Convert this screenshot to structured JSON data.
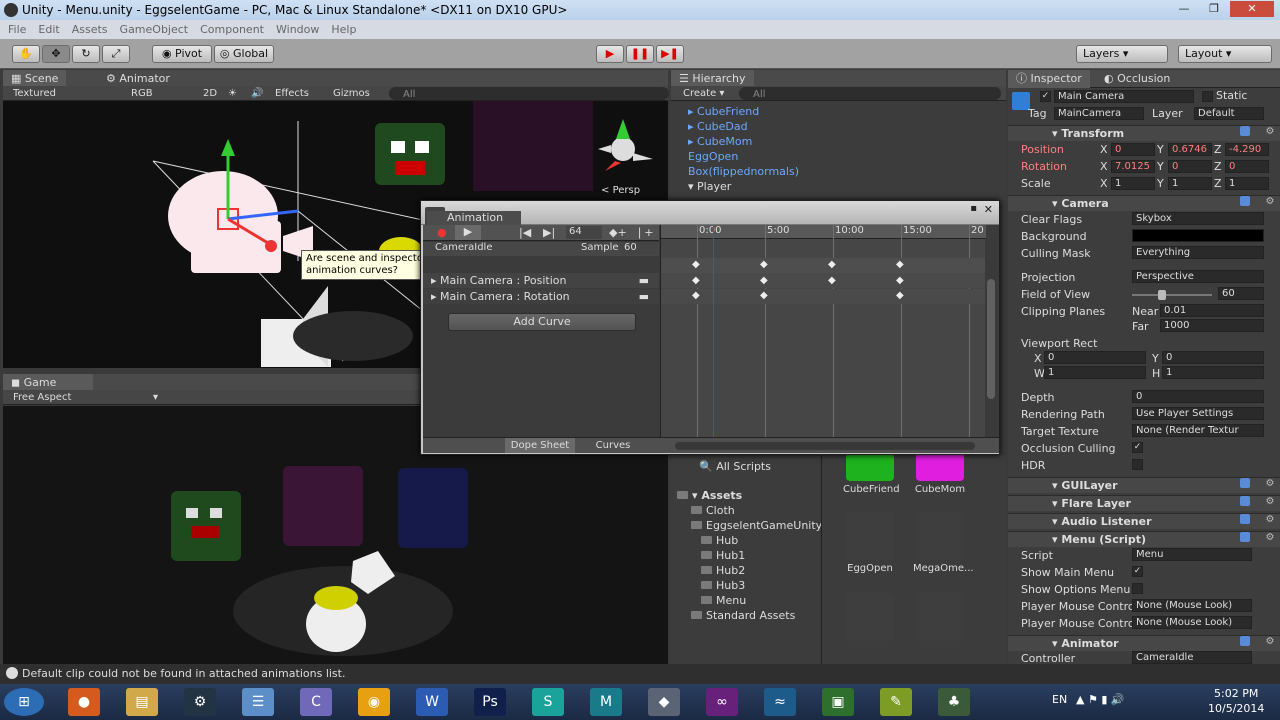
{
  "window": {
    "title": "Unity - Menu.unity - EggselentGame - PC, Mac & Linux Standalone* <DX11 on DX10 GPU>",
    "controls": [
      "—",
      "❐",
      "✕"
    ]
  },
  "menu": [
    "File",
    "Edit",
    "Assets",
    "GameObject",
    "Component",
    "Window",
    "Help"
  ],
  "toolbar": {
    "pivot": "Pivot",
    "global": "Global",
    "layers": "Layers",
    "layout": "Layout"
  },
  "scene": {
    "tabs": [
      "Scene",
      "Animator"
    ],
    "shading": "Textured",
    "rgb": "RGB",
    "mode2d": "2D",
    "effects": "Effects",
    "gizmos": "Gizmos",
    "search_placeholder": "All",
    "persp": "Persp",
    "tooltip": "Are scene and inspector changes recorded into the animation curves?"
  },
  "game": {
    "tab": "Game",
    "aspect": "Free Aspect"
  },
  "hierarchy": {
    "tab": "Hierarchy",
    "create": "Create",
    "search_placeholder": "All",
    "items": [
      "CubeFriend",
      "CubeDad",
      "CubeMom",
      "EggOpen",
      "Box(flippednormals)",
      "Player"
    ]
  },
  "animation": {
    "title": "Animation",
    "frame": "64",
    "clip": "CameraIdle",
    "sample_label": "Sample",
    "sample_value": "60",
    "props": [
      "Main Camera : Position",
      "Main Camera : Rotation"
    ],
    "add_curve": "Add Curve",
    "ruler": [
      "0:00",
      "5:00",
      "10:00",
      "15:00",
      "20"
    ],
    "bottom_tabs": [
      "Dope Sheet",
      "Curves"
    ],
    "playhead_fraction": 0.05
  },
  "project": {
    "all_scripts": "All Scripts",
    "assets": "Assets",
    "folders": [
      "Cloth",
      "EggselentGameUnity",
      "Hub",
      "Hub1",
      "Hub2",
      "Hub3",
      "Menu",
      "Standard Assets"
    ],
    "assets_grid": [
      "CubeFriend",
      "CubeMom",
      "EggOpen",
      "MegaOme...",
      "",
      ""
    ]
  },
  "inspector": {
    "tabs": [
      "Inspector",
      "Occlusion"
    ],
    "object_name": "Main Camera",
    "static": "Static",
    "tag_label": "Tag",
    "tag_value": "MainCamera",
    "layer_label": "Layer",
    "layer_value": "Default",
    "transform": {
      "title": "Transform",
      "position": {
        "label": "Position",
        "x": "0",
        "y": "0.6746",
        "z": "-4.290"
      },
      "rotation": {
        "label": "Rotation",
        "x": "7.0125",
        "y": "0",
        "z": "0"
      },
      "scale": {
        "label": "Scale",
        "x": "1",
        "y": "1",
        "z": "1"
      }
    },
    "camera": {
      "title": "Camera",
      "clear_flags": "Skybox",
      "background_label": "Background",
      "culling_mask": "Everything",
      "projection": "Perspective",
      "fov": "60",
      "near": "0.01",
      "far": "1000",
      "viewport": {
        "x": "0",
        "y": "0",
        "w": "1",
        "h": "1"
      },
      "depth": "0",
      "rendering_path": "Use Player Settings",
      "target_texture": "None (Render Textur",
      "labels": {
        "clear_flags": "Clear Flags",
        "culling_mask": "Culling Mask",
        "projection": "Projection",
        "fov": "Field of View",
        "clipping": "Clipping Planes",
        "near": "Near",
        "far": "Far",
        "viewport": "Viewport Rect",
        "depth": "Depth",
        "rendering_path": "Rendering Path",
        "target_texture": "Target Texture",
        "occlusion": "Occlusion Culling",
        "hdr": "HDR"
      }
    },
    "components": [
      "GUILayer",
      "Flare Layer",
      "Audio Listener",
      "Menu (Script)",
      "Animator"
    ],
    "script": {
      "script_label": "Script",
      "script_value": "Menu",
      "show_main": "Show Main Menu",
      "show_options": "Show Options Menu",
      "mouse_label_1": "Player Mouse Contro",
      "mouse_value_1": "None (Mouse Look)",
      "mouse_label_2": "Player Mouse Contro",
      "mouse_value_2": "None (Mouse Look)"
    },
    "animator": {
      "controller_label": "Controller",
      "controller_value": "CameraIdle"
    }
  },
  "status": "Default clip could not be found in attached animations list.",
  "taskbar": {
    "lang": "EN",
    "time": "5:02 PM",
    "date": "10/5/2014"
  },
  "colors": {
    "accent": "#d00000",
    "hierarchy_link": "#6aa8ff",
    "taskbar": "#1b2a44"
  }
}
